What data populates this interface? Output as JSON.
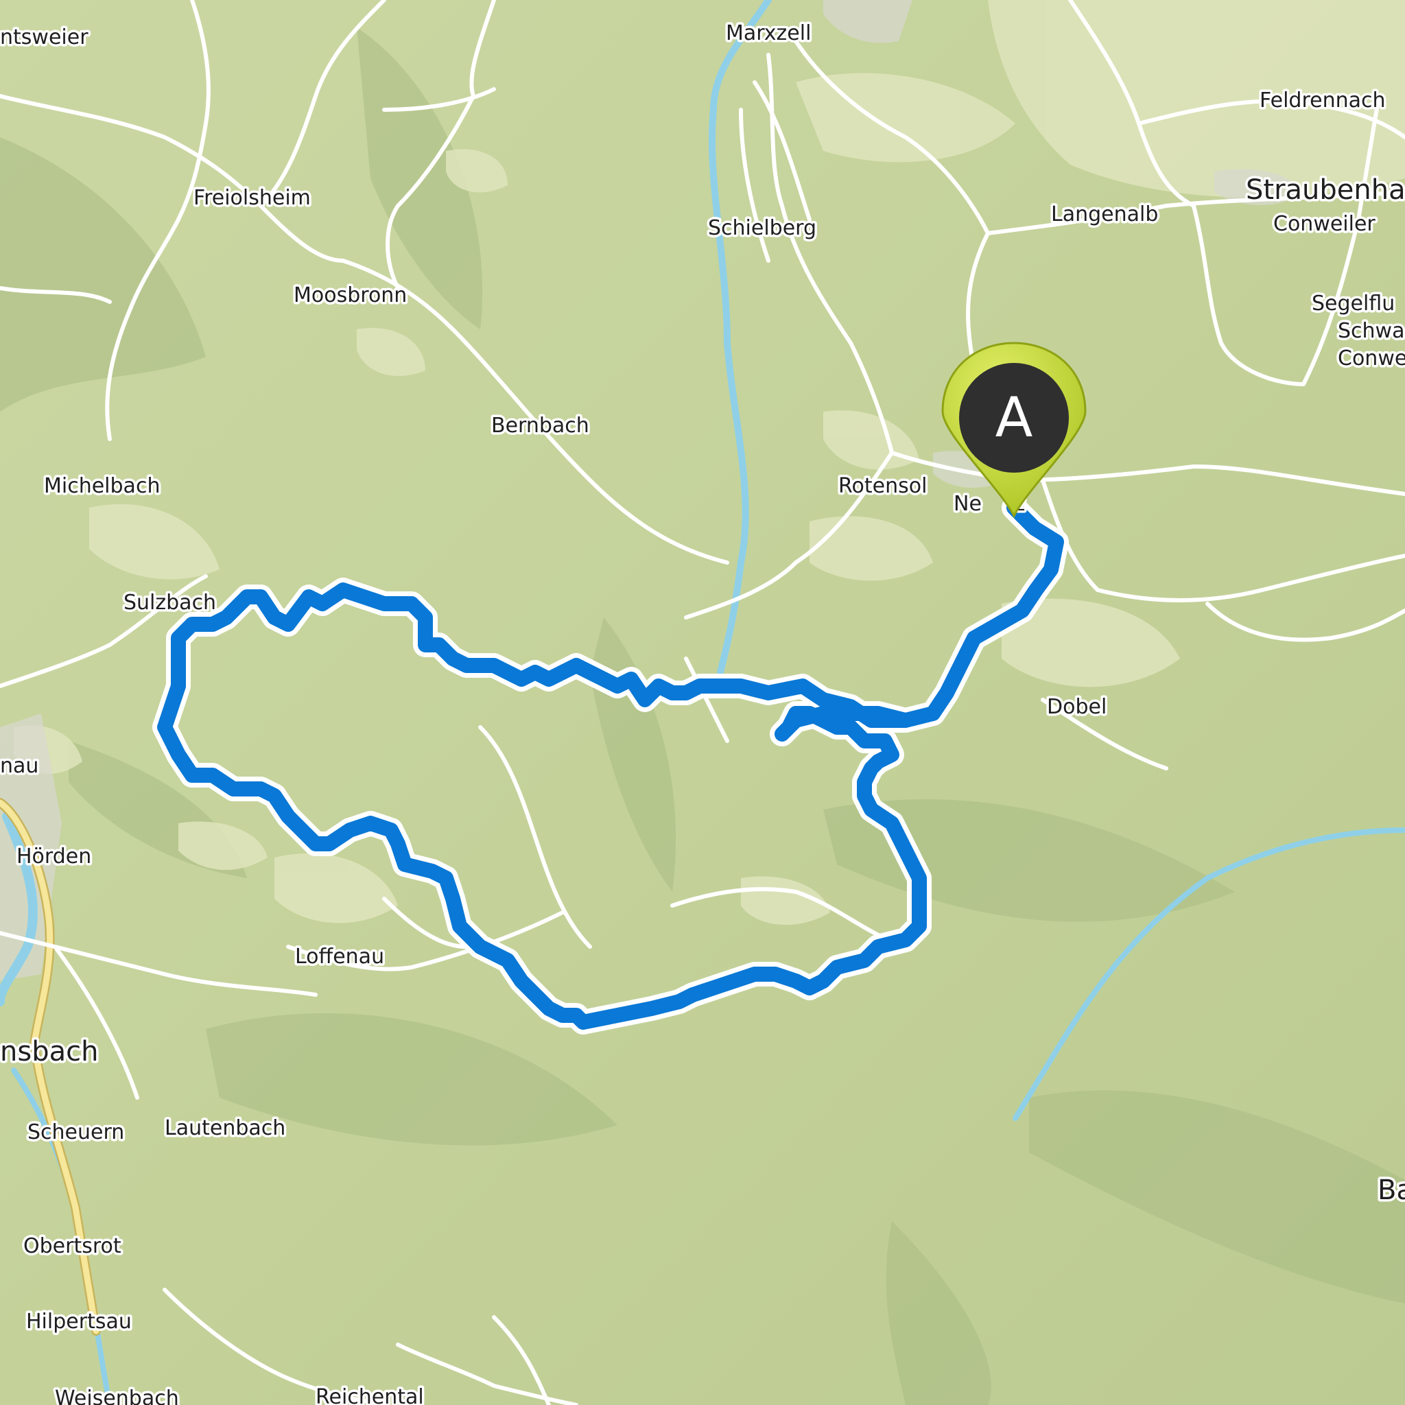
{
  "map": {
    "colors": {
      "terrain": "#c9d6a0",
      "terrain_dark": "#a9bb84",
      "terrain_light": "#dfe4bc",
      "road": "#ffffff",
      "highway": "#f6e79a",
      "river": "#8fd0e8",
      "route": "#0a78d6",
      "route_outline": "#ffffff",
      "marker_fill": "#c6dc3c",
      "marker_head": "#2f2f2f"
    },
    "route_marker": {
      "label": "A"
    },
    "places": [
      {
        "name": "ntsweier"
      },
      {
        "name": "Marxzell"
      },
      {
        "name": "Feldrennach"
      },
      {
        "name": "Straubenha"
      },
      {
        "name": "Freiolsheim"
      },
      {
        "name": "Schielberg"
      },
      {
        "name": "Langenalb"
      },
      {
        "name": "Conweiler"
      },
      {
        "name": "Moosbronn"
      },
      {
        "name": "Segelflu"
      },
      {
        "name": "Schwa"
      },
      {
        "name": "Conwe"
      },
      {
        "name": "Bernbach"
      },
      {
        "name": "Michelbach"
      },
      {
        "name": "Rotensol"
      },
      {
        "name": "Ne     z"
      },
      {
        "name": "Sulzbach"
      },
      {
        "name": "Dobel"
      },
      {
        "name": "nau"
      },
      {
        "name": "Hörden"
      },
      {
        "name": "Loffenau"
      },
      {
        "name": "nsbach"
      },
      {
        "name": "Scheuern"
      },
      {
        "name": "Lautenbach"
      },
      {
        "name": "Ba"
      },
      {
        "name": "Obertsrot"
      },
      {
        "name": "Hilpertsau"
      },
      {
        "name": "Weisenbach"
      },
      {
        "name": "Reichental"
      }
    ]
  }
}
